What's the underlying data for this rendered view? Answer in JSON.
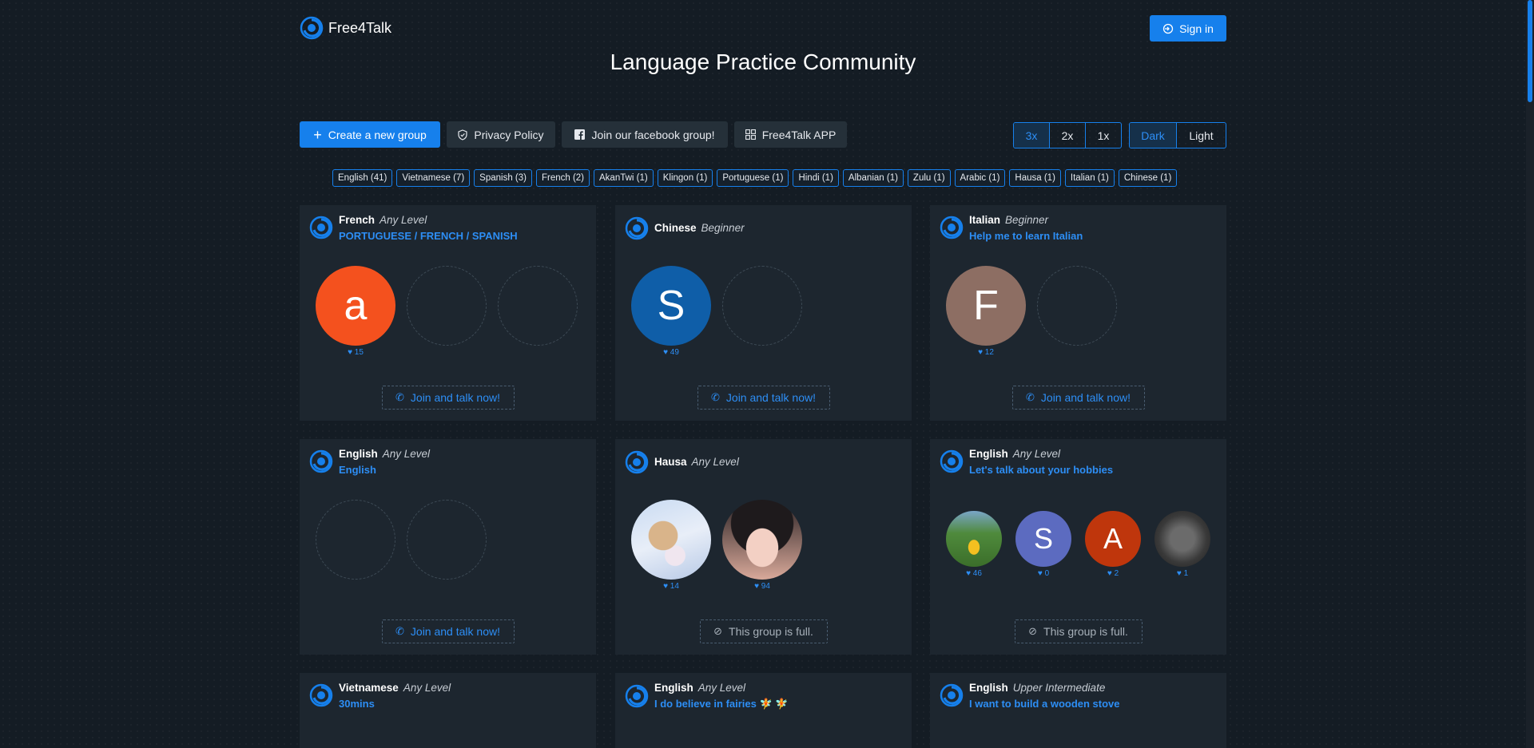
{
  "header": {
    "logo_text": "Free4Talk",
    "sign_in_label": "Sign in",
    "title": "Language Practice Community"
  },
  "toolbar": {
    "create_group": "Create a new group",
    "privacy_policy": "Privacy Policy",
    "facebook_group": "Join our facebook group!",
    "app": "Free4Talk APP"
  },
  "size_options": [
    "3x",
    "2x",
    "1x"
  ],
  "size_selected": "3x",
  "theme_options": [
    "Dark",
    "Light"
  ],
  "theme_selected": "Dark",
  "filters": [
    "English (41)",
    "Vietnamese (7)",
    "Spanish (3)",
    "French (2)",
    "AkanTwi (1)",
    "Klingon (1)",
    "Portuguese (1)",
    "Hindi (1)",
    "Albanian (1)",
    "Zulu (1)",
    "Arabic (1)",
    "Hausa (1)",
    "Italian (1)",
    "Chinese (1)"
  ],
  "labels": {
    "join": "Join and talk now!",
    "full": "This group is full."
  },
  "colors": {
    "accent": "#1680ec",
    "link": "#2d8ef5",
    "card_bg": "#1d262f",
    "page_bg": "#141c24"
  },
  "groups": [
    {
      "language": "French",
      "level": "Any Level",
      "topic": "PORTUGUESE / FRENCH / SPANISH",
      "members": [
        {
          "letter": "a",
          "color": "#f4511e",
          "likes": "15"
        }
      ],
      "empty_slots": 2,
      "status": "join"
    },
    {
      "language": "Chinese",
      "level": "Beginner",
      "topic": "",
      "members": [
        {
          "letter": "S",
          "color": "#0f5ea8",
          "likes": "49"
        }
      ],
      "empty_slots": 1,
      "status": "join"
    },
    {
      "language": "Italian",
      "level": "Beginner",
      "topic": "Help me to learn Italian",
      "members": [
        {
          "letter": "F",
          "color": "#8d6e63",
          "likes": "12"
        }
      ],
      "empty_slots": 1,
      "status": "join"
    },
    {
      "language": "English",
      "level": "Any Level",
      "topic": "English",
      "members": [],
      "empty_slots": 2,
      "status": "join"
    },
    {
      "language": "Hausa",
      "level": "Any Level",
      "topic": "",
      "members": [
        {
          "letter": "",
          "photo": "cat-photo",
          "likes": "14"
        },
        {
          "letter": "",
          "photo": "woman-photo",
          "likes": "94"
        }
      ],
      "empty_slots": 0,
      "status": "full"
    },
    {
      "language": "English",
      "level": "Any Level",
      "topic": "Let's talk about your hobbies",
      "members": [
        {
          "letter": "",
          "photo": "field-photo",
          "likes": "46"
        },
        {
          "letter": "S",
          "color": "#5c6bc0",
          "likes": "0"
        },
        {
          "letter": "A",
          "color": "#bf360c",
          "likes": "2"
        },
        {
          "letter": "",
          "photo": "courage-photo",
          "likes": "1"
        }
      ],
      "empty_slots": 0,
      "status": "full"
    },
    {
      "language": "Vietnamese",
      "level": "Any Level",
      "topic": "30mins",
      "members": [],
      "empty_slots": 0,
      "status": ""
    },
    {
      "language": "English",
      "level": "Any Level",
      "topic": "I do believe in fairies 🧚 🧚",
      "members": [],
      "empty_slots": 0,
      "status": ""
    },
    {
      "language": "English",
      "level": "Upper Intermediate",
      "topic": "I want to build a wooden stove",
      "members": [],
      "empty_slots": 0,
      "status": ""
    }
  ]
}
